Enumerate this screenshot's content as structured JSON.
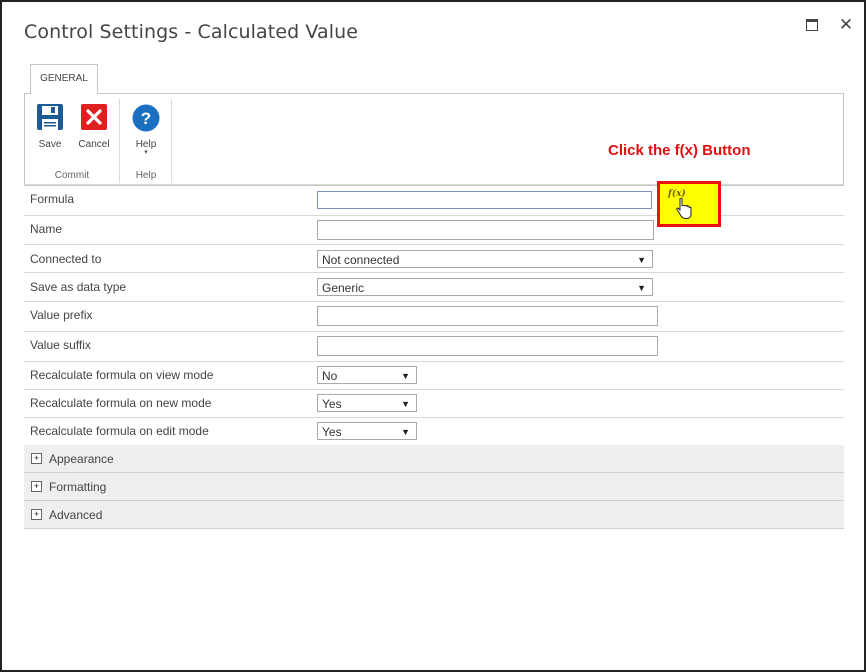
{
  "window": {
    "title": "Control Settings - Calculated Value",
    "maximize_icon": "maximize-icon",
    "close_glyph": "✕"
  },
  "tabs": [
    {
      "label": "GENERAL"
    }
  ],
  "ribbon": {
    "commit": {
      "group_label": "Commit",
      "save_label": "Save",
      "cancel_label": "Cancel"
    },
    "help": {
      "group_label": "Help",
      "help_label": "Help"
    }
  },
  "annotation": {
    "callout": "Click the f(x) Button"
  },
  "fields": {
    "formula": {
      "label": "Formula",
      "value": ""
    },
    "name": {
      "label": "Name",
      "value": ""
    },
    "connected_to": {
      "label": "Connected to",
      "value": "Not connected"
    },
    "save_as_data_type": {
      "label": "Save as data type",
      "value": "Generic"
    },
    "value_prefix": {
      "label": "Value prefix",
      "value": ""
    },
    "value_suffix": {
      "label": "Value suffix",
      "value": ""
    },
    "recalc_view": {
      "label": "Recalculate formula on view mode",
      "value": "No"
    },
    "recalc_new": {
      "label": "Recalculate formula on new mode",
      "value": "Yes"
    },
    "recalc_edit": {
      "label": "Recalculate formula on edit mode",
      "value": "Yes"
    }
  },
  "fx_button": {
    "label": "f(x)"
  },
  "sections": [
    {
      "label": "Appearance"
    },
    {
      "label": "Formatting"
    },
    {
      "label": "Advanced"
    }
  ],
  "colors": {
    "callout": "#e01010",
    "highlight_fill": "#ffff00",
    "highlight_border": "#ee1111",
    "save_icon": "#1e5a96",
    "cancel_icon": "#e02020",
    "help_icon": "#1a6fc0"
  }
}
